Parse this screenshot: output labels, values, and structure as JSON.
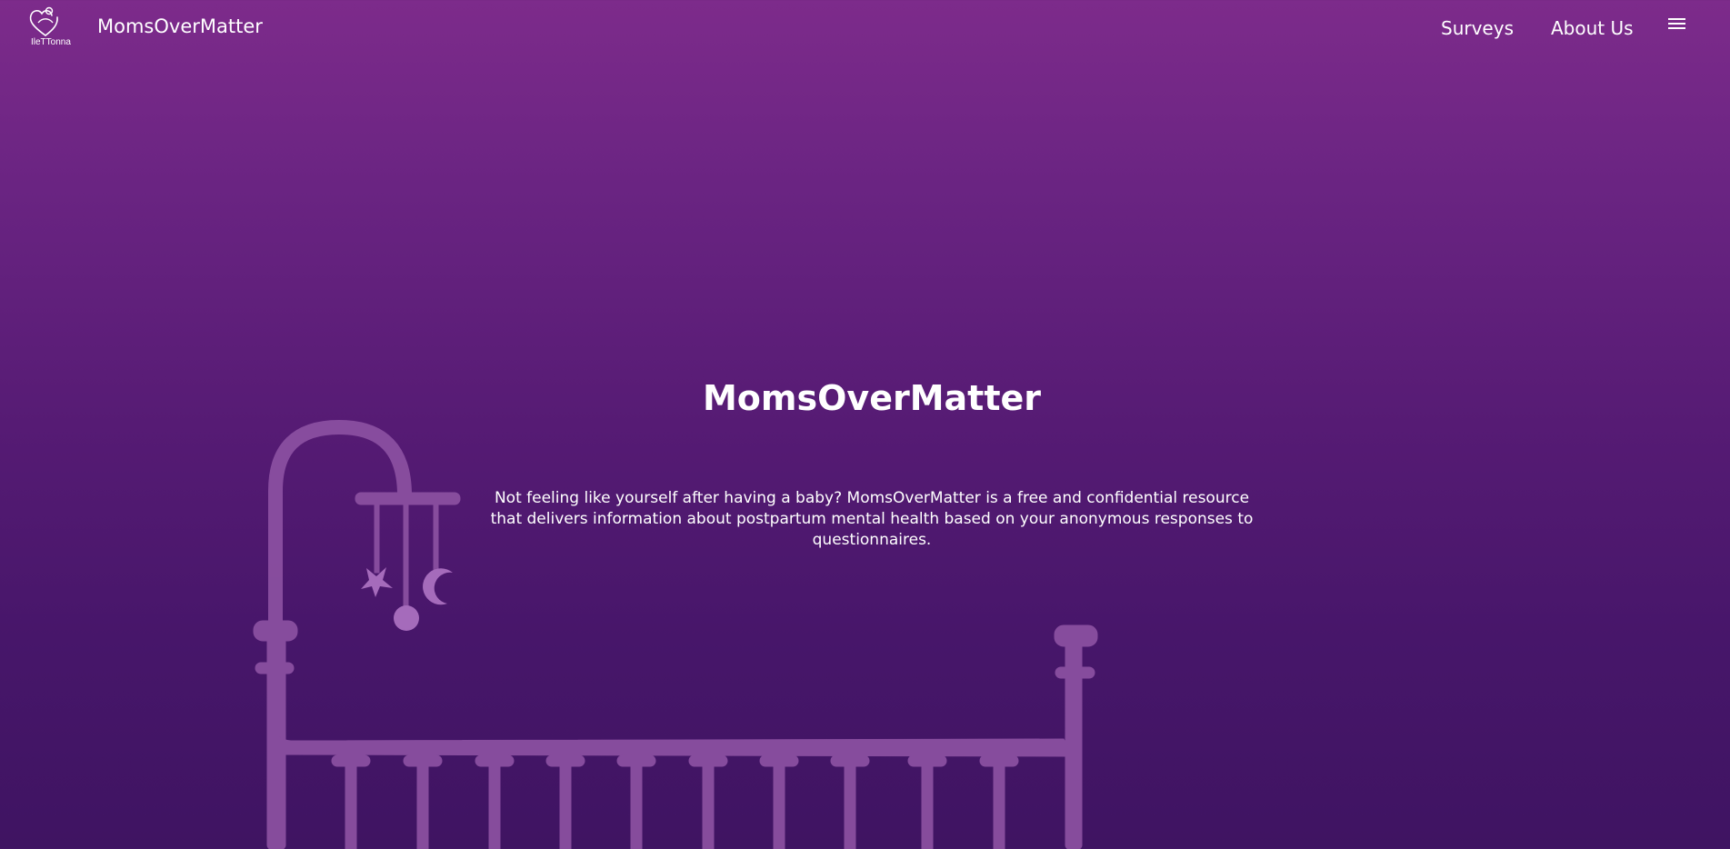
{
  "nav": {
    "logo_text": "IleTTonna",
    "brand": "MomsOverMatter",
    "links": [
      {
        "label": "Surveys"
      },
      {
        "label": "About Us"
      }
    ],
    "menu_icon": "hamburger-menu-icon"
  },
  "hero": {
    "title": "MomsOverMatter",
    "description": "Not feeling like yourself after having a baby? MomsOverMatter is a free and confidential resource that delivers information about postpartum mental health based on your anonymous responses to questionnaires."
  },
  "colors": {
    "gradient_top": "#7d2b8b",
    "gradient_bottom": "#3f1462",
    "crib": "#8a4fa0",
    "mobile_toys": "#a56bbb",
    "text": "#ffffff"
  }
}
